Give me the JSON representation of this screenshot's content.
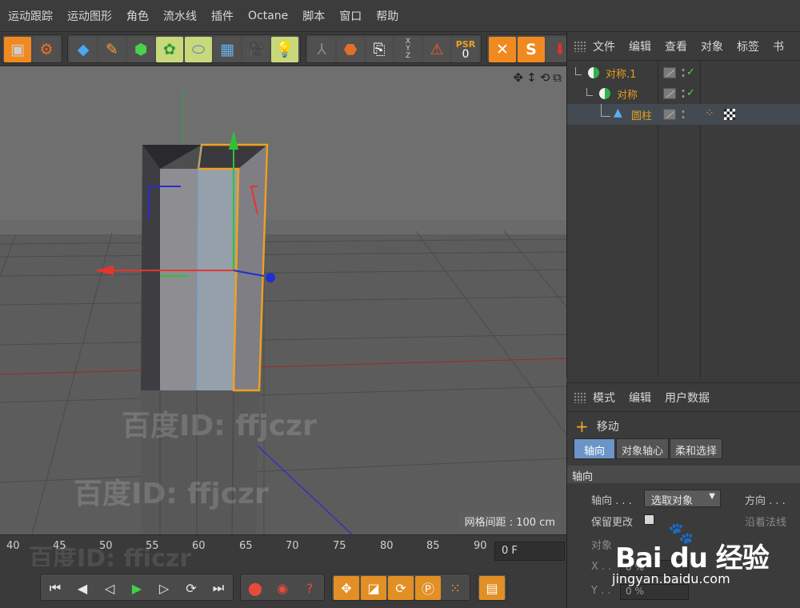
{
  "menu": [
    "运动跟踪",
    "运动图形",
    "角色",
    "流水线",
    "插件",
    "Octane",
    "脚本",
    "窗口",
    "帮助"
  ],
  "toolbar": {
    "psr_label": "PSR",
    "psr_value": "0",
    "axis_labels": [
      "X",
      "Y",
      "Z"
    ]
  },
  "viewport": {
    "grid_spacing": "网格间距 : 100 cm",
    "watermarks": [
      "百度ID: ffjczr",
      "百度ID: ffjczr",
      "百度ID: ffjczr"
    ]
  },
  "timeline": {
    "ticks": [
      "40",
      "45",
      "50",
      "55",
      "60",
      "65",
      "70",
      "75",
      "80",
      "85",
      "90"
    ],
    "frame": "0 F"
  },
  "object_manager": {
    "menu": [
      "文件",
      "编辑",
      "查看",
      "对象",
      "标签",
      "书"
    ],
    "objects": [
      {
        "name": "对称.1"
      },
      {
        "name": "对称"
      },
      {
        "name": "圆柱"
      }
    ]
  },
  "attributes": {
    "menu": [
      "模式",
      "编辑",
      "用户数据"
    ],
    "tool_name": "移动",
    "tabs": [
      "轴向",
      "对象轴心",
      "柔和选择"
    ],
    "section": "轴向",
    "axis_label": "轴向 . . .",
    "axis_value": "选取对象",
    "direction_label": "方向 . . .",
    "keep_changes_label": "保留更改",
    "along_normal_label": "沿着法线",
    "object_label": "对象",
    "x_label": "X . .",
    "x_value": "0 %",
    "y_label": "Y . .",
    "y_value": "0 %"
  },
  "branding": {
    "logo_text": "Bai du 经验",
    "url": "jingyan.baidu.com"
  },
  "colors": {
    "selection_orange": "#f0a020",
    "axis_red": "#e8342c",
    "axis_green": "#2ec23a",
    "axis_blue": "#1f2fd0"
  }
}
